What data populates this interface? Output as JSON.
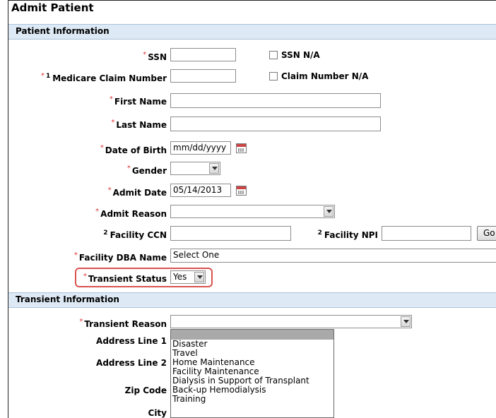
{
  "window": {
    "title": "Admit Patient"
  },
  "sections": {
    "patient_info": "Patient Information",
    "transient_info": "Transient Information"
  },
  "fields": {
    "ssn": {
      "label": "SSN",
      "value": ""
    },
    "ssn_na": {
      "label": "SSN N/A",
      "checked": false
    },
    "medicare": {
      "label": "Medicare Claim Number",
      "note": "1",
      "value": ""
    },
    "claim_na": {
      "label": "Claim Number N/A",
      "checked": false
    },
    "first_name": {
      "label": "First Name",
      "value": ""
    },
    "last_name": {
      "label": "Last Name",
      "value": ""
    },
    "dob": {
      "label": "Date of Birth",
      "value": "mm/dd/yyyy"
    },
    "gender": {
      "label": "Gender",
      "value": ""
    },
    "admit_date": {
      "label": "Admit Date",
      "value": "05/14/2013"
    },
    "admit_reason": {
      "label": "Admit Reason",
      "value": ""
    },
    "facility_ccn": {
      "label": "Facility CCN",
      "note": "2",
      "value": ""
    },
    "facility_npi": {
      "label": "Facility NPI",
      "note": "2",
      "value": ""
    },
    "go_button": "Go",
    "facility_dba": {
      "label": "Facility DBA Name",
      "value": "Select One"
    },
    "transient_status": {
      "label": "Transient Status",
      "value": "Yes"
    },
    "transient_reason": {
      "label": "Transient Reason",
      "value": ""
    },
    "address1": {
      "label": "Address Line 1"
    },
    "address2": {
      "label": "Address Line 2"
    },
    "zip": {
      "label": "Zip Code"
    },
    "city": {
      "label": "City"
    }
  },
  "required_marker": "*",
  "transient_reason_options": [
    "",
    "Disaster",
    "Travel",
    "Home Maintenance",
    "Facility Maintenance",
    "Dialysis in Support of Transplant",
    "Back-up Hemodialysis",
    "Training"
  ],
  "colors": {
    "section_bg": "#dde9f4",
    "highlight": "#d9534f",
    "required": "#dd3333"
  }
}
